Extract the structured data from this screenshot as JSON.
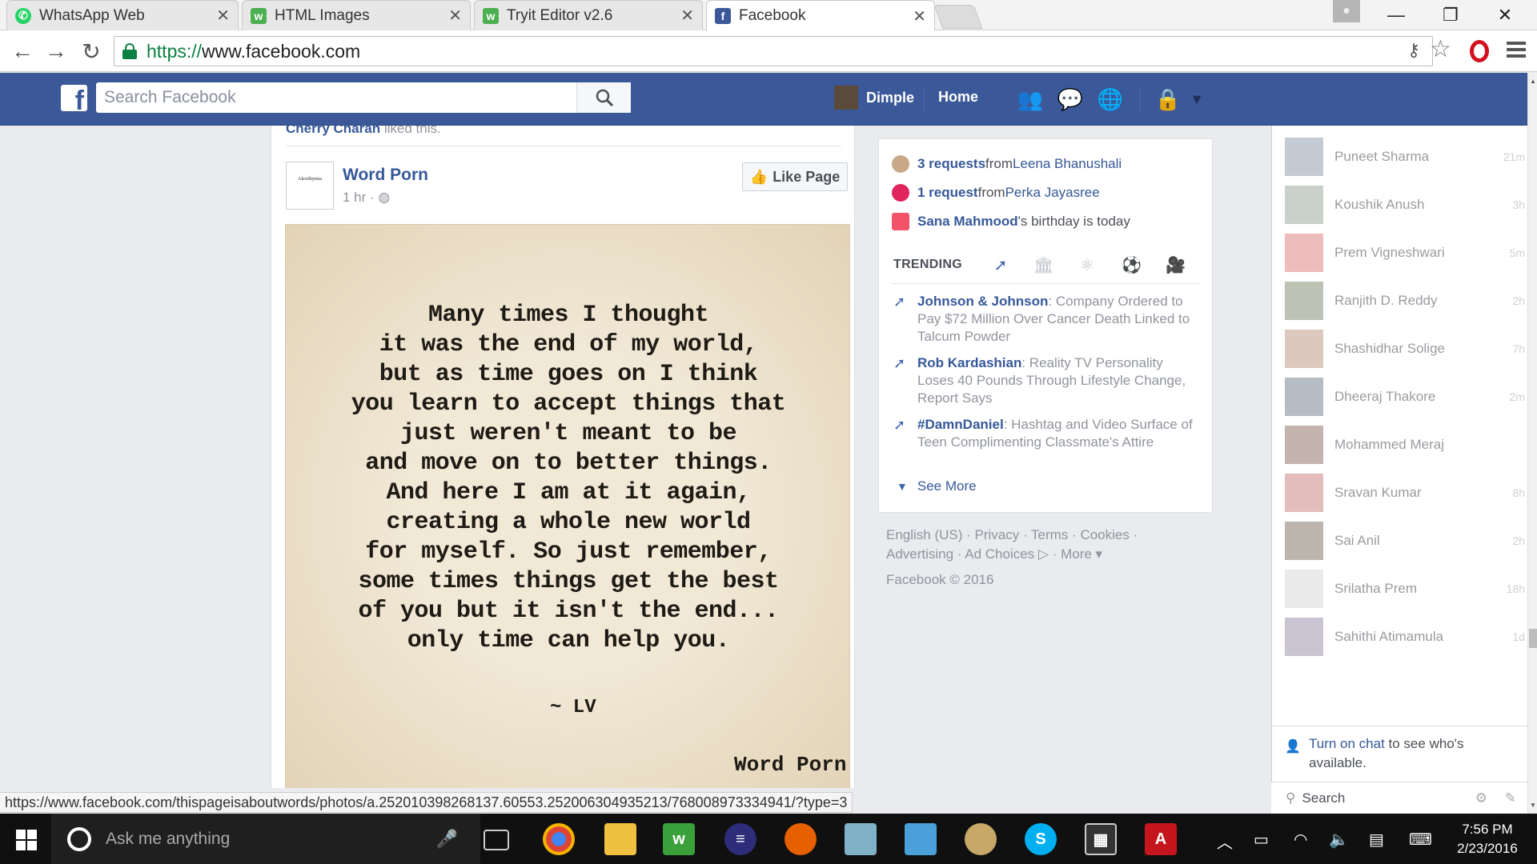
{
  "tabs": [
    {
      "title": "WhatsApp Web",
      "icon": "whatsapp-icon",
      "color": "#25d366"
    },
    {
      "title": "HTML Images",
      "icon": "w3schools-icon",
      "color": "#4caf50"
    },
    {
      "title": "Tryit Editor v2.6",
      "icon": "w3schools-icon",
      "color": "#4caf50"
    },
    {
      "title": "Facebook",
      "icon": "facebook-icon",
      "color": "#3b5998"
    }
  ],
  "address": {
    "scheme": "https://",
    "host": "www.facebook.com"
  },
  "fb": {
    "search_placeholder": "Search Facebook",
    "user": "Dimple",
    "home": "Home",
    "brand_color": "#3b5998"
  },
  "post": {
    "liked_name": "Cherry Charan",
    "liked_text": " liked this.",
    "page_name": "Word Porn",
    "time": "1 hr ·",
    "avatar_text": "Alexithymia",
    "like_button": "Like Page",
    "quote": "Many times I thought\nit was the end of my world,\nbut as time goes on I think\nyou learn to accept things that\njust weren't meant to be\nand move on to better things.\nAnd here I am at it again,\ncreating a whole new world\nfor myself. So just remember,\nsome times things get the best\nof you but it isn't the end...\nonly time can help you.",
    "signature": "~ LV",
    "brand": "Word Porn"
  },
  "requests": [
    {
      "link": "3 requests",
      "text": " from ",
      "who": "Leena Bhanushali"
    },
    {
      "link": "1 request",
      "text": " from ",
      "who": "Perka Jayasree"
    },
    {
      "link": "Sana Mahmood",
      "text": "'s birthday is today",
      "who": ""
    }
  ],
  "trending": {
    "heading": "TRENDING",
    "items": [
      {
        "title": "Johnson & Johnson",
        "text": ": Company Ordered to Pay $72 Million Over Cancer Death Linked to Talcum Powder"
      },
      {
        "title": "Rob Kardashian",
        "text": ": Reality TV Personality Loses 40 Pounds Through Lifestyle Change, Report Says"
      },
      {
        "title": "#DamnDaniel",
        "text": ": Hashtag and Video Surface of Teen Complimenting Classmate's Attire"
      }
    ],
    "see_more": "See More"
  },
  "footer": {
    "line1": "English (US) · Privacy · Terms · Cookies ·",
    "line2": "Advertising · Ad Choices ▷ · More ▾",
    "copyright": "Facebook © 2016"
  },
  "friends": [
    {
      "name": "Puneet Sharma",
      "time": "21m",
      "color": "#7b8aa0"
    },
    {
      "name": "Koushik Anush",
      "time": "3h",
      "color": "#8a9a8a"
    },
    {
      "name": "Prem Vigneshwari",
      "time": "5m",
      "color": "#d96a6a"
    },
    {
      "name": "Ranjith D. Reddy",
      "time": "2h",
      "color": "#6a7a5a"
    },
    {
      "name": "Shashidhar Solige",
      "time": "7h",
      "color": "#b08870"
    },
    {
      "name": "Dheeraj Thakore",
      "time": "2m",
      "color": "#5a6a7a"
    },
    {
      "name": "Mohammed Meraj",
      "time": "",
      "color": "#7a5a4a"
    },
    {
      "name": "Sravan Kumar",
      "time": "8h",
      "color": "#c06a6a"
    },
    {
      "name": "Sai Anil",
      "time": "2h",
      "color": "#6a5a4a"
    },
    {
      "name": "Srilatha Prem",
      "time": "18h",
      "color": "#d0d0d0"
    },
    {
      "name": "Sahithi Atimamula",
      "time": "1d",
      "color": "#8a7a9a"
    }
  ],
  "chat": {
    "turn_on": "Turn on chat",
    "rest": " to see who's available.",
    "search": "Search"
  },
  "status_url": "https://www.facebook.com/thispageisaboutwords/photos/a.252010398268137.60553.252006304935213/768008973334941/?type=3",
  "taskbar": {
    "cortana": "Ask me anything",
    "time": "7:56 PM",
    "date": "2/23/2016"
  }
}
